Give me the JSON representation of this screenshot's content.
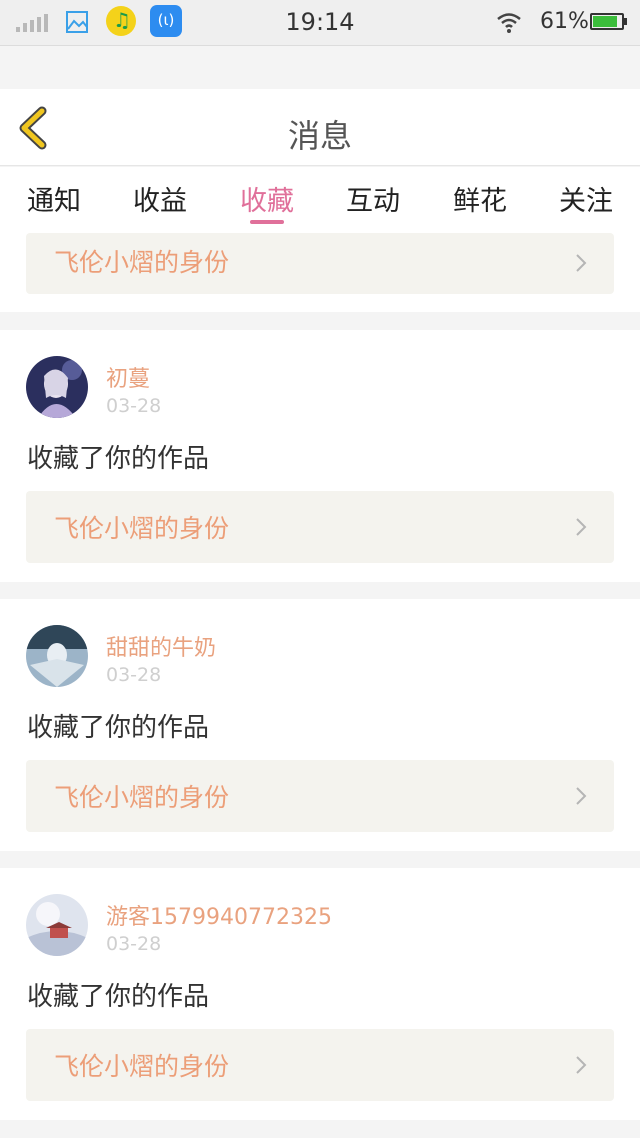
{
  "status_bar": {
    "time": "19:14",
    "battery": "61%",
    "app_icon_text": "(ɩ)"
  },
  "header": {
    "title": "消息",
    "back_icon": "chevron-left-icon"
  },
  "tabs": [
    {
      "label": "通知",
      "active": false
    },
    {
      "label": "收益",
      "active": false
    },
    {
      "label": "收藏",
      "active": true
    },
    {
      "label": "互动",
      "active": false
    },
    {
      "label": "鲜花",
      "active": false
    },
    {
      "label": "关注",
      "active": false
    }
  ],
  "partial_item": {
    "work_title": "飞伦小熠的身份"
  },
  "items": [
    {
      "user": "初蔓",
      "date": "03-28",
      "action": "收藏了你的作品",
      "work_title": "飞伦小熠的身份"
    },
    {
      "user": "甜甜的牛奶",
      "date": "03-28",
      "action": "收藏了你的作品",
      "work_title": "飞伦小熠的身份"
    },
    {
      "user": "游客1579940772325",
      "date": "03-28",
      "action": "收藏了你的作品",
      "work_title": "飞伦小熠的身份"
    }
  ],
  "colors": {
    "accent": "#e0709a",
    "name": "#e9a27f",
    "link_bg": "#f4f3ee",
    "back_arrow": "#f0c61f"
  }
}
